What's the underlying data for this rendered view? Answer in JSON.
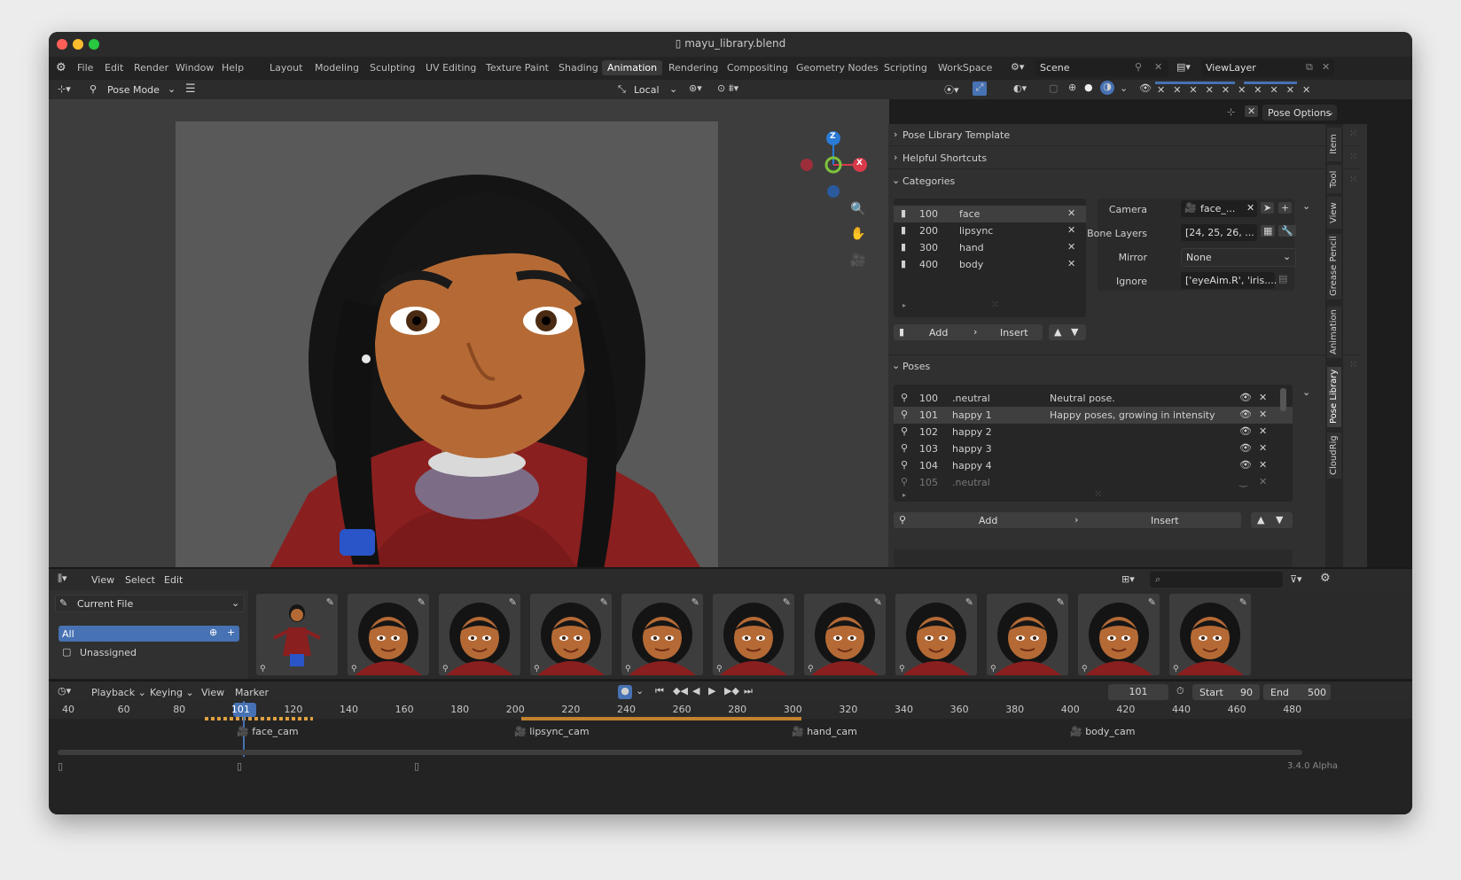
{
  "window": {
    "title": "mayu_library.blend",
    "version": "3.4.0 Alpha"
  },
  "menu": {
    "items": [
      "File",
      "Edit",
      "Render",
      "Window",
      "Help"
    ]
  },
  "workspaces": {
    "tabs": [
      "Layout",
      "Modeling",
      "Sculpting",
      "UV Editing",
      "Texture Paint",
      "Shading",
      "Animation",
      "Rendering",
      "Compositing",
      "Geometry Nodes",
      "Scripting",
      "WorkSpace"
    ],
    "active": "Animation"
  },
  "scene": {
    "scene_name": "Scene",
    "view_layer": "ViewLayer"
  },
  "viewport": {
    "mode": "Pose Mode",
    "transform_orientation": "Local",
    "pose_options": "Pose Options",
    "gizmo_axes": {
      "z": "Z",
      "x": "X"
    }
  },
  "sidebar_tabs": [
    "Item",
    "Tool",
    "View",
    "Grease Pencil",
    "Animation",
    "Pose Library",
    "CloudRig"
  ],
  "panels": {
    "pose_library_template": "Pose Library Template",
    "helpful_shortcuts": "Helpful Shortcuts",
    "categories": "Categories",
    "poses": "Poses"
  },
  "categories": {
    "rows": [
      {
        "num": "100",
        "name": "face"
      },
      {
        "num": "200",
        "name": "lipsync"
      },
      {
        "num": "300",
        "name": "hand"
      },
      {
        "num": "400",
        "name": "body"
      }
    ],
    "add": "Add",
    "insert": "Insert"
  },
  "properties": {
    "camera_label": "Camera",
    "camera_value": "face_...",
    "bone_layers_label": "Bone Layers",
    "bone_layers_value": "[24, 25, 26, ...",
    "mirror_label": "Mirror",
    "mirror_value": "None",
    "ignore_label": "Ignore",
    "ignore_value": "['eyeAim.R', 'iris...."
  },
  "poses": {
    "rows": [
      {
        "num": "100",
        "name": ".neutral",
        "desc": "Neutral pose."
      },
      {
        "num": "101",
        "name": "happy 1",
        "desc": "Happy poses, growing in intensity"
      },
      {
        "num": "102",
        "name": "happy 2",
        "desc": ""
      },
      {
        "num": "103",
        "name": "happy 3",
        "desc": ""
      },
      {
        "num": "104",
        "name": "happy 4",
        "desc": ""
      },
      {
        "num": "105",
        "name": ".neutral",
        "desc": ""
      }
    ],
    "add": "Add",
    "insert": "Insert"
  },
  "asset_browser": {
    "menus": [
      "View",
      "Select",
      "Edit"
    ],
    "library": "Current File",
    "catalogs": [
      "All",
      "Unassigned"
    ]
  },
  "timeline": {
    "menus": [
      "Playback",
      "Keying",
      "View",
      "Marker"
    ],
    "current_frame": "101",
    "start_label": "Start",
    "start": "90",
    "end_label": "End",
    "end": "500",
    "ticks": [
      "40",
      "60",
      "80",
      "101",
      "120",
      "140",
      "160",
      "180",
      "200",
      "220",
      "240",
      "260",
      "280",
      "300",
      "320",
      "340",
      "360",
      "380",
      "400",
      "420",
      "440",
      "460",
      "480"
    ],
    "markers": [
      "face_cam",
      "lipsync_cam",
      "hand_cam",
      "body_cam"
    ]
  },
  "colors": {
    "accent": "#4772b3",
    "active_tab": "#3a3a3a",
    "highlight_orange": "#e0a040"
  }
}
